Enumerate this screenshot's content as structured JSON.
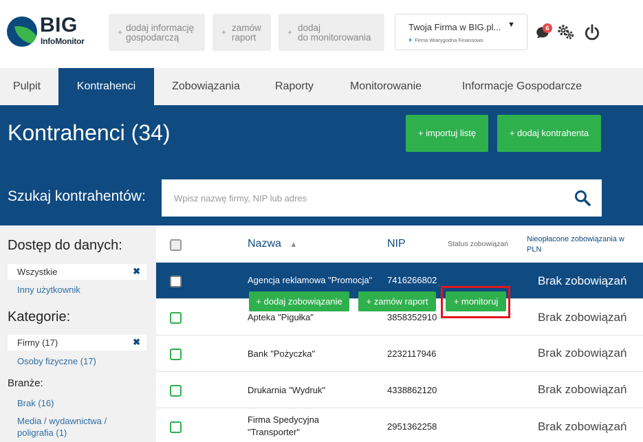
{
  "brand": {
    "name": "BIG",
    "subtitle": "InfoMonitor"
  },
  "quick_actions": [
    {
      "label_line1": "dodaj informację",
      "label_line2": "gospodarczą"
    },
    {
      "label_line1": "zamów",
      "label_line2": "raport"
    },
    {
      "label_line1": "dodaj",
      "label_line2": "do monitorowania"
    }
  ],
  "plus": "+",
  "firm": {
    "name": "Twoja Firma w BIG.pl...",
    "caret": "▼",
    "subtitle": "Firma Wiarygodna Finansowo",
    "diamond": "♦"
  },
  "notifications": {
    "count": "6"
  },
  "nav": {
    "items": [
      "Pulpit",
      "Kontrahenci",
      "Zobowiązania",
      "Raporty",
      "Monitorowanie",
      "Informacje Gospodarcze"
    ],
    "active": "Kontrahenci"
  },
  "page": {
    "title": "Kontrahenci (34)",
    "import_label": "+ importuj listę",
    "add_label": "+ dodaj kontrahenta"
  },
  "search": {
    "label": "Szukaj kontrahentów:",
    "placeholder": "Wpisz nazwę firmy, NIP lub adres"
  },
  "sidebar": {
    "access_heading": "Dostęp do danych:",
    "access_selected": "Wszystkie",
    "access_other": "Inny użytkownik",
    "categories_heading": "Kategorie:",
    "cat_selected": "Firmy (17)",
    "cat_other": "Osoby fizyczne (17)",
    "industries_heading": "Branże:",
    "industries": [
      "Brak (16)",
      "Media / wydawnictwa / poligrafia (1)"
    ],
    "remove": "✖"
  },
  "table": {
    "headers": {
      "name": "Nazwa",
      "sort": "▲",
      "nip": "NIP",
      "status": "Status zobowiązań",
      "unpaid": "Nieopłacone zobowiązania w PLN"
    },
    "rows": [
      {
        "name": "Agencja reklamowa \"Promocja\"",
        "nip": "7416266802",
        "status": "Brak zobowiązań"
      },
      {
        "name": "Apteka \"Pigułka\"",
        "nip": "3858352910",
        "status": "Brak zobowiązań"
      },
      {
        "name": "Bank \"Pożyczka\"",
        "nip": "2232117946",
        "status": "Brak zobowiązań"
      },
      {
        "name": "Drukarnia \"Wydruk\"",
        "nip": "4338862120",
        "status": "Brak zobowiązań"
      },
      {
        "name_line1": "Firma Spedycyjna",
        "name_line2": "\"Transporter\"",
        "nip": "2951362258",
        "status": "Brak zobowiązań"
      }
    ],
    "row_actions": {
      "add_obligation": "+ dodaj zobowiązanie",
      "order_report": "+ zamów raport",
      "monitor": "+ monitoruj"
    }
  },
  "colors": {
    "brand_blue": "#0f4a80",
    "action_green": "#2eb04d",
    "highlight_red": "#e0141e"
  }
}
